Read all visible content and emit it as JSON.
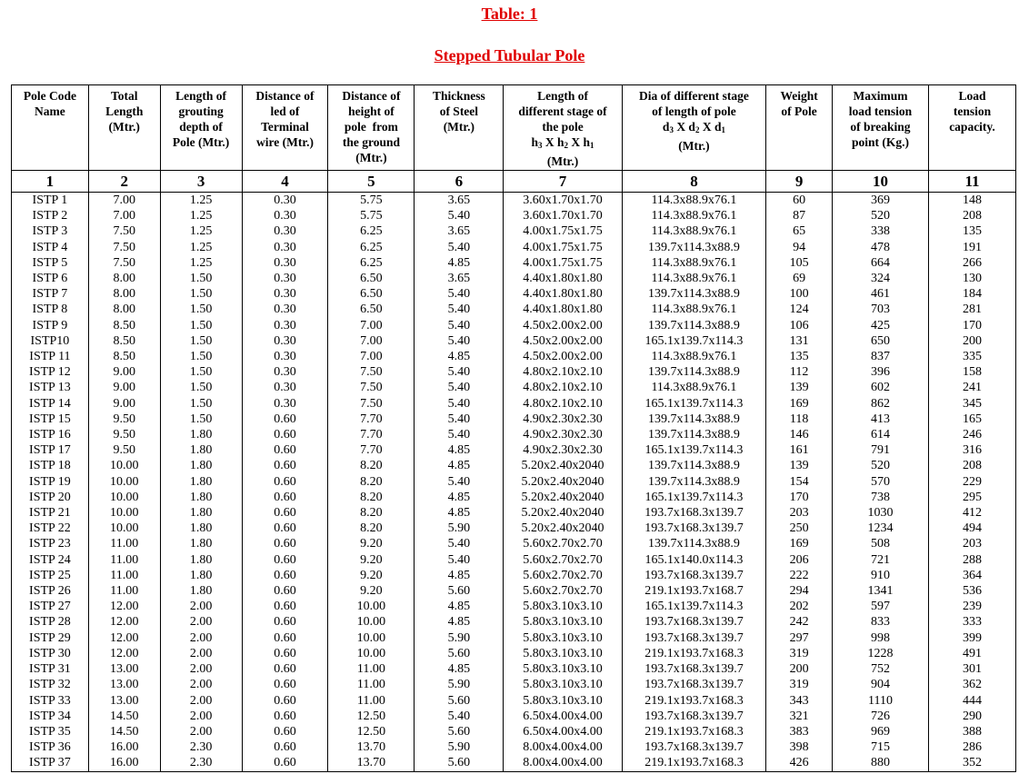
{
  "title": "Table: 1",
  "subtitle": "Stepped Tubular  Pole",
  "columns": [
    {
      "header": "Pole Code Name",
      "num": "1"
    },
    {
      "header": "Total Length (Mtr.)",
      "num": "2"
    },
    {
      "header": "Length of grouting depth of Pole (Mtr.)",
      "num": "3"
    },
    {
      "header": "Distance of led of Terminal wire (Mtr.)",
      "num": "4"
    },
    {
      "header": "Distance of height of pole  from the ground (Mtr.)",
      "num": "5"
    },
    {
      "header": "Thickness of Steel (Mtr.)",
      "num": "6"
    },
    {
      "header": "Length of different stage of the pole h3 X h2 X h1 (Mtr.)",
      "num": "7"
    },
    {
      "header": "Dia of different stage of length of pole d3 X d2 X d1 (Mtr.)",
      "num": "8"
    },
    {
      "header": "Weight of Pole",
      "num": "9"
    },
    {
      "header": "Maximum load tension of breaking point (Kg.)",
      "num": "10"
    },
    {
      "header": "Load tension capacity.",
      "num": "11"
    }
  ],
  "rows": [
    [
      "ISTP 1",
      "7.00",
      "1.25",
      "0.30",
      "5.75",
      "3.65",
      "3.60x1.70x1.70",
      "114.3x88.9x76.1",
      "60",
      "369",
      "148"
    ],
    [
      "ISTP  2",
      "7.00",
      "1.25",
      "0.30",
      "5.75",
      "5.40",
      "3.60x1.70x1.70",
      "114.3x88.9x76.1",
      "87",
      "520",
      "208"
    ],
    [
      "ISTP 3",
      "7.50",
      "1.25",
      "0.30",
      "6.25",
      "3.65",
      "4.00x1.75x1.75",
      "114.3x88.9x76.1",
      "65",
      "338",
      "135"
    ],
    [
      "ISTP 4",
      "7.50",
      "1.25",
      "0.30",
      "6.25",
      "5.40",
      "4.00x1.75x1.75",
      "139.7x114.3x88.9",
      "94",
      "478",
      "191"
    ],
    [
      "ISTP 5",
      "7.50",
      "1.25",
      "0.30",
      "6.25",
      "4.85",
      "4.00x1.75x1.75",
      "114.3x88.9x76.1",
      "105",
      "664",
      "266"
    ],
    [
      "ISTP 6",
      "8.00",
      "1.50",
      "0.30",
      "6.50",
      "3.65",
      "4.40x1.80x1.80",
      "114.3x88.9x76.1",
      "69",
      "324",
      "130"
    ],
    [
      "ISTP 7",
      "8.00",
      "1.50",
      "0.30",
      "6.50",
      "5.40",
      "4.40x1.80x1.80",
      "139.7x114.3x88.9",
      "100",
      "461",
      "184"
    ],
    [
      "ISTP 8",
      "8.00",
      "1.50",
      "0.30",
      "6.50",
      "5.40",
      "4.40x1.80x1.80",
      "114.3x88.9x76.1",
      "124",
      "703",
      "281"
    ],
    [
      "ISTP 9",
      "8.50",
      "1.50",
      "0.30",
      "7.00",
      "5.40",
      "4.50x2.00x2.00",
      "139.7x114.3x88.9",
      "106",
      "425",
      "170"
    ],
    [
      "ISTP10",
      "8.50",
      "1.50",
      "0.30",
      "7.00",
      "5.40",
      "4.50x2.00x2.00",
      "165.1x139.7x114.3",
      "131",
      "650",
      "200"
    ],
    [
      "ISTP 11",
      "8.50",
      "1.50",
      "0.30",
      "7.00",
      "4.85",
      "4.50x2.00x2.00",
      "114.3x88.9x76.1",
      "135",
      "837",
      "335"
    ],
    [
      "ISTP 12",
      "9.00",
      "1.50",
      "0.30",
      "7.50",
      "5.40",
      "4.80x2.10x2.10",
      "139.7x114.3x88.9",
      "112",
      "396",
      "158"
    ],
    [
      "ISTP 13",
      "9.00",
      "1.50",
      "0.30",
      "7.50",
      "5.40",
      "4.80x2.10x2.10",
      "114.3x88.9x76.1",
      "139",
      "602",
      "241"
    ],
    [
      "ISTP 14",
      "9.00",
      "1.50",
      "0.30",
      "7.50",
      "5.40",
      "4.80x2.10x2.10",
      "165.1x139.7x114.3",
      "169",
      "862",
      "345"
    ],
    [
      "ISTP 15",
      "9.50",
      "1.50",
      "0.60",
      "7.70",
      "5.40",
      "4.90x2.30x2.30",
      "139.7x114.3x88.9",
      "118",
      "413",
      "165"
    ],
    [
      "ISTP 16",
      "9.50",
      "1.80",
      "0.60",
      "7.70",
      "5.40",
      "4.90x2.30x2.30",
      "139.7x114.3x88.9",
      "146",
      "614",
      "246"
    ],
    [
      "ISTP 17",
      "9.50",
      "1.80",
      "0.60",
      "7.70",
      "4.85",
      "4.90x2.30x2.30",
      "165.1x139.7x114.3",
      "161",
      "791",
      "316"
    ],
    [
      "ISTP 18",
      "10.00",
      "1.80",
      "0.60",
      "8.20",
      "4.85",
      "5.20x2.40x2040",
      "139.7x114.3x88.9",
      "139",
      "520",
      "208"
    ],
    [
      "ISTP 19",
      "10.00",
      "1.80",
      "0.60",
      "8.20",
      "5.40",
      "5.20x2.40x2040",
      "139.7x114.3x88.9",
      "154",
      "570",
      "229"
    ],
    [
      "ISTP 20",
      "10.00",
      "1.80",
      "0.60",
      "8.20",
      "4.85",
      "5.20x2.40x2040",
      "165.1x139.7x114.3",
      "170",
      "738",
      "295"
    ],
    [
      "ISTP 21",
      "10.00",
      "1.80",
      "0.60",
      "8.20",
      "4.85",
      "5.20x2.40x2040",
      "193.7x168.3x139.7",
      "203",
      "1030",
      "412"
    ],
    [
      "ISTP 22",
      "10.00",
      "1.80",
      "0.60",
      "8.20",
      "5.90",
      "5.20x2.40x2040",
      "193.7x168.3x139.7",
      "250",
      "1234",
      "494"
    ],
    [
      "ISTP 23",
      "11.00",
      "1.80",
      "0.60",
      "9.20",
      "5.40",
      "5.60x2.70x2.70",
      "139.7x114.3x88.9",
      "169",
      "508",
      "203"
    ],
    [
      "ISTP 24",
      "11.00",
      "1.80",
      "0.60",
      "9.20",
      "5.40",
      "5.60x2.70x2.70",
      "165.1x140.0x114.3",
      "206",
      "721",
      "288"
    ],
    [
      "ISTP 25",
      "11.00",
      "1.80",
      "0.60",
      "9.20",
      "4.85",
      "5.60x2.70x2.70",
      "193.7x168.3x139.7",
      "222",
      "910",
      "364"
    ],
    [
      "ISTP 26",
      "11.00",
      "1.80",
      "0.60",
      "9.20",
      "5.60",
      "5.60x2.70x2.70",
      "219.1x193.7x168.7",
      "294",
      "1341",
      "536"
    ],
    [
      "ISTP 27",
      "12.00",
      "2.00",
      "0.60",
      "10.00",
      "4.85",
      "5.80x3.10x3.10",
      "165.1x139.7x114.3",
      "202",
      "597",
      "239"
    ],
    [
      "ISTP 28",
      "12.00",
      "2.00",
      "0.60",
      "10.00",
      "4.85",
      "5.80x3.10x3.10",
      "193.7x168.3x139.7",
      "242",
      "833",
      "333"
    ],
    [
      "ISTP 29",
      "12.00",
      "2.00",
      "0.60",
      "10.00",
      "5.90",
      "5.80x3.10x3.10",
      "193.7x168.3x139.7",
      "297",
      "998",
      "399"
    ],
    [
      "ISTP 30",
      "12.00",
      "2.00",
      "0.60",
      "10.00",
      "5.60",
      "5.80x3.10x3.10",
      "219.1x193.7x168.3",
      "319",
      "1228",
      "491"
    ],
    [
      "ISTP 31",
      "13.00",
      "2.00",
      "0.60",
      "11.00",
      "4.85",
      "5.80x3.10x3.10",
      "193.7x168.3x139.7",
      "200",
      "752",
      "301"
    ],
    [
      "ISTP 32",
      "13.00",
      "2.00",
      "0.60",
      "11.00",
      "5.90",
      "5.80x3.10x3.10",
      "193.7x168.3x139.7",
      "319",
      "904",
      "362"
    ],
    [
      "ISTP 33",
      "13.00",
      "2.00",
      "0.60",
      "11.00",
      "5.60",
      "5.80x3.10x3.10",
      "219.1x193.7x168.3",
      "343",
      "1110",
      "444"
    ],
    [
      "ISTP 34",
      "14.50",
      "2.00",
      "0.60",
      "12.50",
      "5.40",
      "6.50x4.00x4.00",
      "193.7x168.3x139.7",
      "321",
      "726",
      "290"
    ],
    [
      "ISTP 35",
      "14.50",
      "2.00",
      "0.60",
      "12.50",
      "5.60",
      "6.50x4.00x4.00",
      "219.1x193.7x168.3",
      "383",
      "969",
      "388"
    ],
    [
      "ISTP 36",
      "16.00",
      "2.30",
      "0.60",
      "13.70",
      "5.90",
      "8.00x4.00x4.00",
      "193.7x168.3x139.7",
      "398",
      "715",
      "286"
    ],
    [
      "ISTP 37",
      "16.00",
      "2.30",
      "0.60",
      "13.70",
      "5.60",
      "8.00x4.00x4.00",
      "219.1x193.7x168.3",
      "426",
      "880",
      "352"
    ]
  ]
}
